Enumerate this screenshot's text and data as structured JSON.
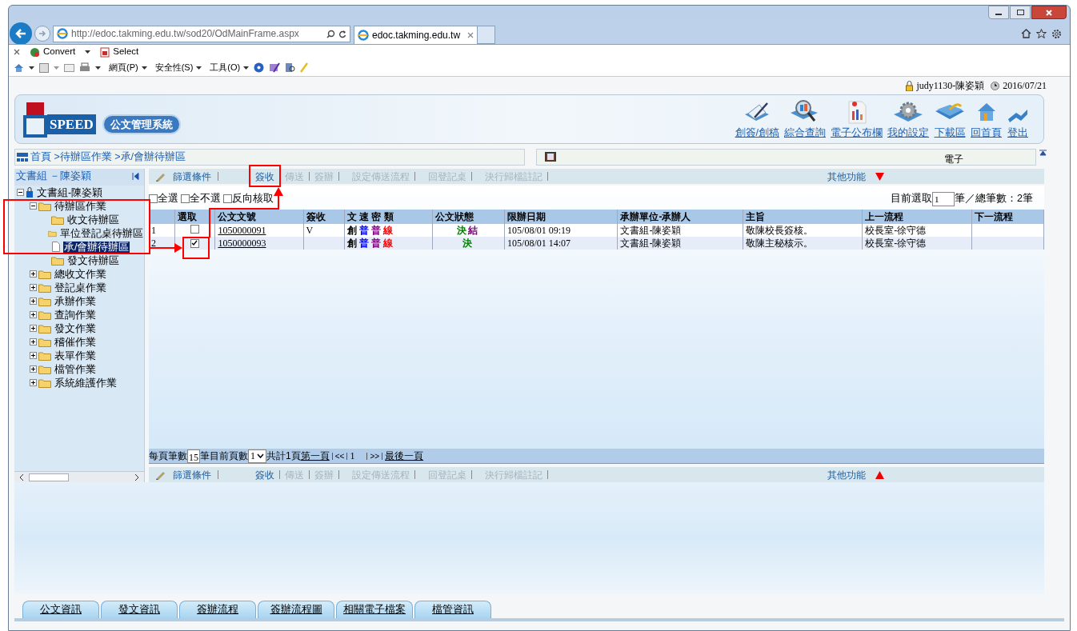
{
  "browser": {
    "address": "http://edoc.takming.edu.tw/sod20/OdMainFrame.aspx",
    "tab_title": "edoc.takming.edu.tw",
    "toolbar": [
      "Convert",
      "Select"
    ],
    "commands": [
      "網頁(P)",
      "安全性(S)",
      "工具(O)"
    ]
  },
  "user": {
    "name": "judy1130-陳姿穎",
    "date": "2016/07/21"
  },
  "header": {
    "logo_text": "SPEED",
    "system_name": "公文管理系統",
    "nav": [
      "創簽/創稿",
      "綜合查詢",
      "電子公布欄",
      "我的設定",
      "下載區",
      "回首頁",
      "登出"
    ]
  },
  "breadcrumb": "首頁 >待辦區作業 >承/會辦待辦區",
  "info_bar": {
    "text": "電子"
  },
  "sidebar": {
    "title": "文書組 －陳姿穎",
    "tree": [
      {
        "label": "文書組-陳姿穎",
        "kind": "root",
        "expanded": true,
        "selected": false,
        "children": [
          {
            "label": "待辦區作業",
            "kind": "folder",
            "expanded": true,
            "selected": false,
            "children": [
              {
                "label": "收文待辦區",
                "kind": "folder",
                "selected": false
              },
              {
                "label": "單位登記桌待辦區",
                "kind": "folder",
                "selected": false
              },
              {
                "label": "承/會辦待辦區",
                "kind": "page",
                "selected": true
              },
              {
                "label": "發文待辦區",
                "kind": "folder",
                "selected": false
              }
            ]
          },
          {
            "label": "總收文作業",
            "kind": "folder",
            "expanded": false,
            "selected": false
          },
          {
            "label": "登記桌作業",
            "kind": "folder",
            "expanded": false,
            "selected": false
          },
          {
            "label": "承辦作業",
            "kind": "folder",
            "expanded": false,
            "selected": false
          },
          {
            "label": "查詢作業",
            "kind": "folder",
            "expanded": false,
            "selected": false
          },
          {
            "label": "發文作業",
            "kind": "folder",
            "expanded": false,
            "selected": false
          },
          {
            "label": "稽催作業",
            "kind": "folder",
            "expanded": false,
            "selected": false
          },
          {
            "label": "表單作業",
            "kind": "folder",
            "expanded": false,
            "selected": false
          },
          {
            "label": "檔管作業",
            "kind": "folder",
            "expanded": false,
            "selected": false
          },
          {
            "label": "系統維護作業",
            "kind": "folder",
            "expanded": false,
            "selected": false
          }
        ]
      }
    ]
  },
  "top_toolbar": {
    "filter": "篩選條件",
    "actions": [
      {
        "label": "簽收",
        "disabled": false
      },
      {
        "label": "傳送",
        "disabled": true
      },
      {
        "label": "簽辦",
        "disabled": true
      },
      {
        "label": "設定傳送流程",
        "disabled": true
      },
      {
        "label": "回登記桌",
        "disabled": true
      },
      {
        "label": "決行歸檔註記",
        "disabled": true
      }
    ],
    "more": "其他功能",
    "more_open": true
  },
  "selection": {
    "options": [
      {
        "label": "全選",
        "checked": false
      },
      {
        "label": "全不選",
        "checked": false
      },
      {
        "label": "反向核取",
        "checked": false
      }
    ],
    "current_label": "目前選取",
    "current_value": "1",
    "total_text": "筆／總筆數：2筆"
  },
  "table": {
    "columns": [
      "選取",
      "公文文號",
      "簽收",
      "文 速 密 類",
      "公文狀態",
      "限辦日期",
      "承辦單位-承辦人",
      "主旨",
      "上一流程",
      "下一流程"
    ],
    "rows": [
      {
        "index": "1",
        "checked": false,
        "number": "1050000091",
        "signed": "V",
        "flags": [
          {
            "text": "創",
            "color": "#000000"
          },
          {
            "text": "普",
            "color": "#0000ff"
          },
          {
            "text": "普",
            "color": "#800080"
          },
          {
            "text": "線",
            "color": "#ff0000"
          }
        ],
        "status": [
          {
            "text": "決",
            "color": "#008000"
          },
          {
            "text": "結",
            "color": "#800080"
          }
        ],
        "due": "105/08/01 09:19",
        "handler": "文書組-陳姿穎",
        "subject": "敬陳校長簽核。",
        "prev": "校長室-徐守德"
      },
      {
        "index": "2",
        "checked": true,
        "number": "1050000093",
        "flags": [
          {
            "text": "創",
            "color": "#000000"
          },
          {
            "text": "普",
            "color": "#0000ff"
          },
          {
            "text": "普",
            "color": "#800080"
          },
          {
            "text": "線",
            "color": "#ff0000"
          }
        ],
        "status": [
          {
            "text": "決",
            "color": "#008000"
          }
        ],
        "due": "105/08/01 14:07",
        "handler": "文書組-陳姿穎",
        "subject": "敬陳主秘核示。",
        "prev": "校長室-徐守德"
      }
    ]
  },
  "pagination": {
    "per_page_label": "每頁筆數",
    "per_page": "15",
    "page_label": "筆目前頁數",
    "page": "1",
    "total": "共計1頁",
    "first": "第一頁",
    "prev": "<<",
    "current": "1",
    "next": ">>",
    "last": "最後一頁"
  },
  "bottom_toolbar": {
    "filter": "篩選條件",
    "actions": [
      {
        "label": "簽收",
        "disabled": false
      },
      {
        "label": "傳送",
        "disabled": true
      },
      {
        "label": "簽辦",
        "disabled": true
      },
      {
        "label": "設定傳送流程",
        "disabled": true
      },
      {
        "label": "回登記桌",
        "disabled": true
      },
      {
        "label": "決行歸檔註記",
        "disabled": true
      }
    ],
    "more": "其他功能",
    "more_open": false
  },
  "bottom_tabs": [
    "公文資訊",
    "發文資訊",
    "簽辦流程",
    "簽辦流程圖",
    "相關電子檔案",
    "檔管資訊"
  ]
}
